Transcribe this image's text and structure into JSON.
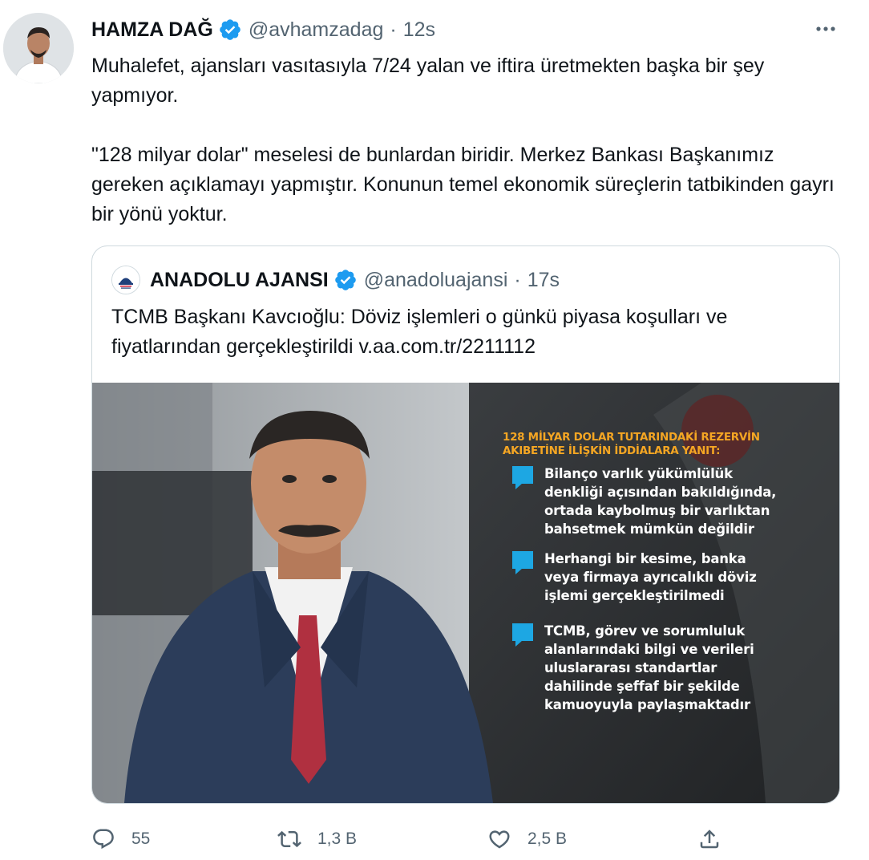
{
  "tweet": {
    "author_name": "HAMZA DAĞ",
    "author_handle": "@avhamzadag",
    "separator": "·",
    "time": "12s",
    "text": "Muhalefet, ajansları vasıtasıyla 7/24 yalan ve iftira üretmekten başka bir şey yapmıyor.\n\n\"128 milyar dolar\" meselesi de bunlardan biridir. Merkez Bankası Başkanımız gereken açıklamayı yapmıştır. Konunun temel ekonomik süreçlerin tatbikinden gayrı bir yönü yoktur."
  },
  "quoted_tweet": {
    "author_name": "ANADOLU AJANSI",
    "author_handle": "@anadoluajansi",
    "separator": "·",
    "time": "17s",
    "text": "TCMB Başkanı Kavcıoğlu: Döviz işlemleri o günkü piyasa koşulları ve fiyatlarından gerçekleştirildi v.aa.com.tr/2211112",
    "image": {
      "title": "128 MİLYAR DOLAR TUTARINDAKİ REZERVİN\nAKIBETİNE İLİŞKİN İDDİALARA YANIT:",
      "items": [
        "Bilanço varlık yükümlülük\ndenkliği açısından bakıldığında,\nortada kaybolmuş bir varlıktan\nbahsetmek mümkün değildir",
        "Herhangi bir kesime, banka\nveya firmaya ayrıcalıklı döviz\nişlemi gerçekleştirilmedi",
        "TCMB, görev ve sorumluluk\nalanlarındaki bilgi ve verileri\nuluslararası standartlar\ndahilinde şeffaf bir şekilde\nkamuoyuyla paylaşmaktadır"
      ]
    }
  },
  "actions": {
    "reply_count": "55",
    "retweet_count": "1,3 B",
    "like_count": "2,5 B"
  },
  "colors": {
    "text": "#0f1419",
    "secondary": "#536471",
    "verified": "#1d9bf0",
    "border": "#cfd9de",
    "infographic_title": "#f5a623",
    "infographic_bullet": "#1da7e3"
  },
  "icons": [
    "verified-badge-icon",
    "more-icon",
    "reply-icon",
    "retweet-icon",
    "like-icon",
    "share-icon"
  ]
}
